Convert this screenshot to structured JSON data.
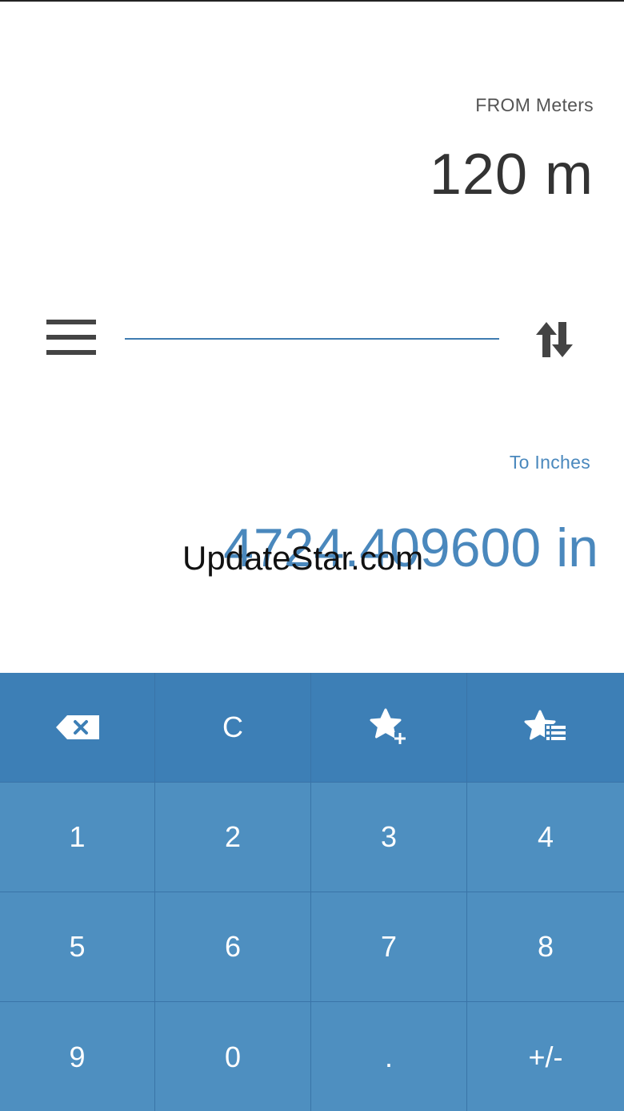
{
  "converter": {
    "from_label": "FROM Meters",
    "from_value": "120 m",
    "to_label": "To Inches",
    "to_value": "4724.409600 in"
  },
  "watermark": "UpdateStar.com",
  "keypad": {
    "backspace_icon": "backspace-icon",
    "clear_label": "C",
    "add_favorite_icon": "star-plus-icon",
    "favorites_list_icon": "star-list-icon",
    "keys": [
      "1",
      "2",
      "3",
      "4",
      "5",
      "6",
      "7",
      "8",
      "9",
      "0",
      ".",
      "+/-"
    ]
  },
  "colors": {
    "accent": "#4a88bd",
    "keypad_top": "#3d7fb6",
    "keypad": "#4e8fc0"
  }
}
